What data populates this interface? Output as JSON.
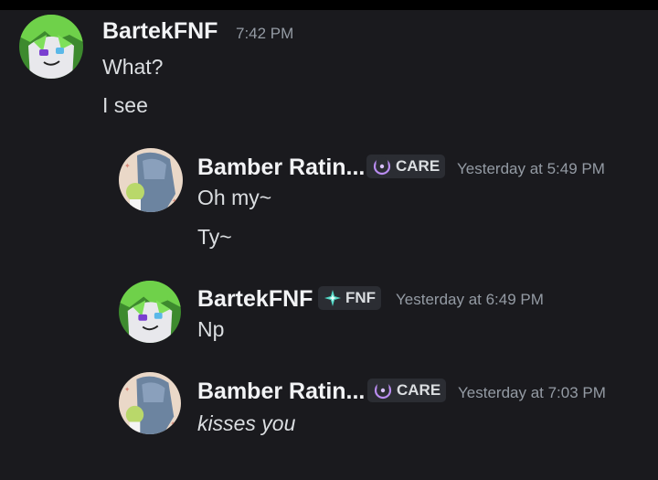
{
  "messages": [
    {
      "username": "BartekFNF",
      "timestamp": "7:42 PM",
      "avatar_icon": "green-haired-character-avatar",
      "lines": [
        "What?",
        "I see"
      ]
    },
    {
      "username": "Bamber Ratin...",
      "timestamp": "Yesterday at 5:49 PM",
      "avatar_icon": "bamber-character-avatar",
      "tag": {
        "label": "CARE",
        "icon": "moon-icon",
        "icon_color": "#b98cf0"
      },
      "lines": [
        "Oh my~",
        "Ty~"
      ]
    },
    {
      "username": "BartekFNF",
      "timestamp": "Yesterday at 6:49 PM",
      "avatar_icon": "green-haired-character-avatar",
      "tag": {
        "label": "FNF",
        "icon": "sparkle-icon",
        "icon_color": "#4fd6c4"
      },
      "lines": [
        "Np"
      ]
    },
    {
      "username": "Bamber Ratin...",
      "timestamp": "Yesterday at 7:03 PM",
      "avatar_icon": "bamber-character-avatar",
      "tag": {
        "label": "CARE",
        "icon": "moon-icon",
        "icon_color": "#b98cf0"
      },
      "lines": [
        "kisses you"
      ]
    }
  ],
  "colors": {
    "background": "#1a1a1e",
    "username": "#f2f3f5",
    "timestamp": "#949ba4",
    "text": "#dbdee1",
    "tag_background": "#2b2d33"
  }
}
